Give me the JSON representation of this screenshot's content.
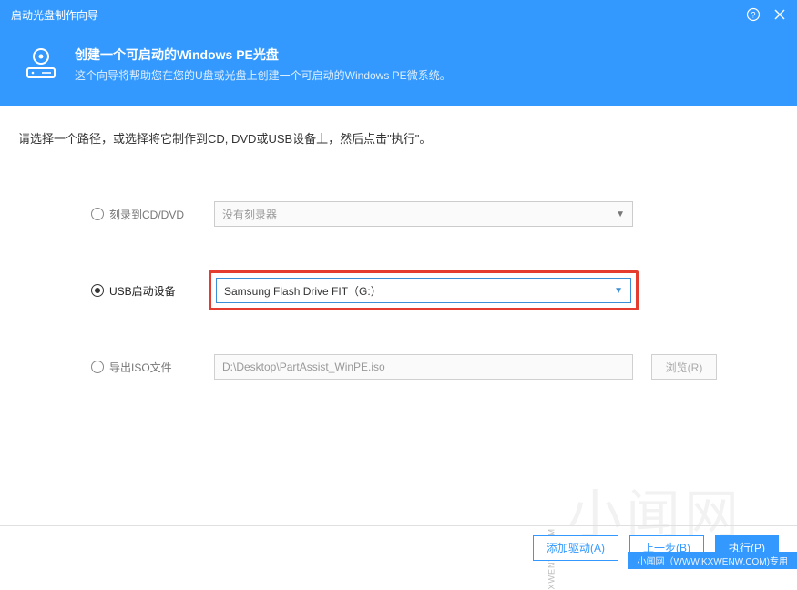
{
  "titlebar": {
    "title": "启动光盘制作向导"
  },
  "header": {
    "title": "创建一个可启动的Windows PE光盘",
    "subtitle": "这个向导将帮助您在您的U盘或光盘上创建一个可启动的Windows PE微系统。"
  },
  "instruction": "请选择一个路径，或选择将它制作到CD, DVD或USB设备上，然后点击\"执行\"。",
  "options": {
    "cd": {
      "label": "刻录到CD/DVD",
      "value": "没有刻录器",
      "selected": false
    },
    "usb": {
      "label": "USB启动设备",
      "value": "Samsung Flash Drive FIT（G:）",
      "selected": true
    },
    "iso": {
      "label": "导出ISO文件",
      "value": "D:\\Desktop\\PartAssist_WinPE.iso",
      "selected": false,
      "browse": "浏览(R)"
    }
  },
  "footer": {
    "add_driver": "添加驱动(A)",
    "prev": "上一步(B)",
    "execute": "执行(P)"
  },
  "watermark": {
    "diag": "XWENW.COM",
    "big": "小闻网",
    "bar": "小闻网（WWW.KXWENW.COM)专用"
  }
}
